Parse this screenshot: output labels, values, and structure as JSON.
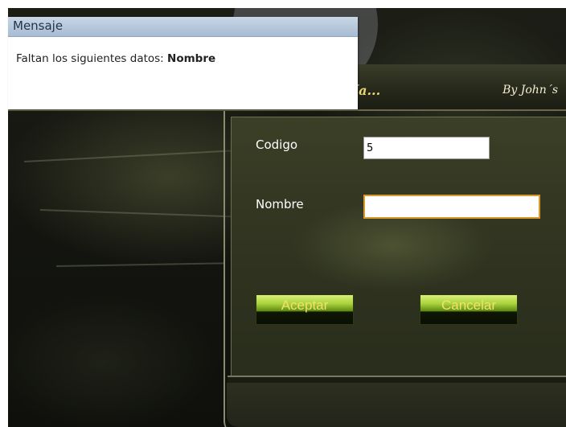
{
  "app": {
    "title_fragment": "ía...",
    "byline": "By John´s"
  },
  "form": {
    "codigo": {
      "label": "Codigo",
      "value": "5"
    },
    "nombre": {
      "label": "Nombre",
      "value": ""
    },
    "accept_label": "Aceptar",
    "cancel_label": "Cancelar"
  },
  "message": {
    "title": "Mensaje",
    "text": "Faltan los siguientes datos: ",
    "field": "Nombre",
    "icon": "question-mark-icon"
  },
  "colors": {
    "title_gold": "#e8d770",
    "button_text": "#f2e26a",
    "dialog_header": "#b8c8dc",
    "focus_border": "#d89a2a"
  }
}
